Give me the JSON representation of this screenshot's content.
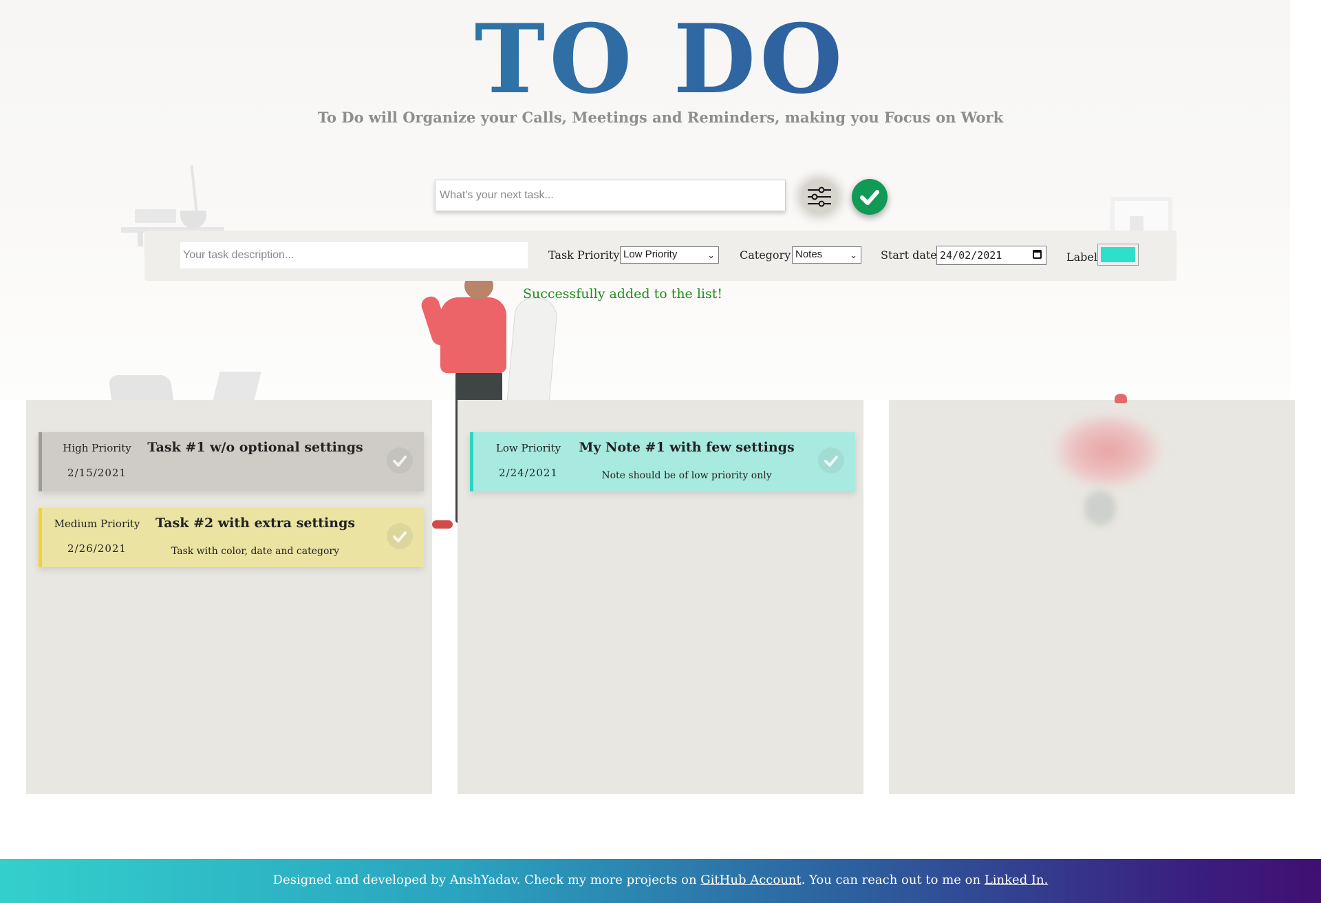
{
  "header": {
    "title": "TO DO",
    "subtitle": "To Do will Organize your Calls, Meetings and Reminders, making you Focus on Work"
  },
  "task_input": {
    "placeholder": "What's your next task..."
  },
  "icons": {
    "settings": "sliders-icon",
    "add": "check-circle-icon",
    "done": "check-icon"
  },
  "options": {
    "description_placeholder": "Your task description...",
    "priority_label": "Task Priority:",
    "priority_value": "Low Priority",
    "category_label": "Category:",
    "category_value": "Notes",
    "start_date_label": "Start date:",
    "start_date_value": "24/02/2021",
    "label_label": "Label",
    "label_color": "#2de0c9"
  },
  "status_message": "Successfully added to the list!",
  "columns": [
    {
      "cards": [
        {
          "priority": "High Priority",
          "date": "2/15/2021",
          "title": "Task #1 w/o optional settings",
          "description": "",
          "color": "#cfccc7",
          "border": "#9f9c97"
        },
        {
          "priority": "Medium Priority",
          "date": "2/26/2021",
          "title": "Task #2 with extra settings",
          "description": "Task with color, date and category",
          "color": "#ebe3a1",
          "border": "#f2d23a"
        }
      ]
    },
    {
      "cards": [
        {
          "priority": "Low Priority",
          "date": "2/24/2021",
          "title": "My Note #1 with few settings",
          "description": "Note should be of low priority only",
          "color": "#a8eadf",
          "border": "#2ad6c2"
        }
      ]
    },
    {
      "cards": []
    }
  ],
  "footer": {
    "text_before": "Designed and developed by AnshYadav. Check my more projects on ",
    "github_link": "GitHub Account",
    "text_middle": ". You can reach out to me on ",
    "linkedin_link": "Linked In."
  }
}
